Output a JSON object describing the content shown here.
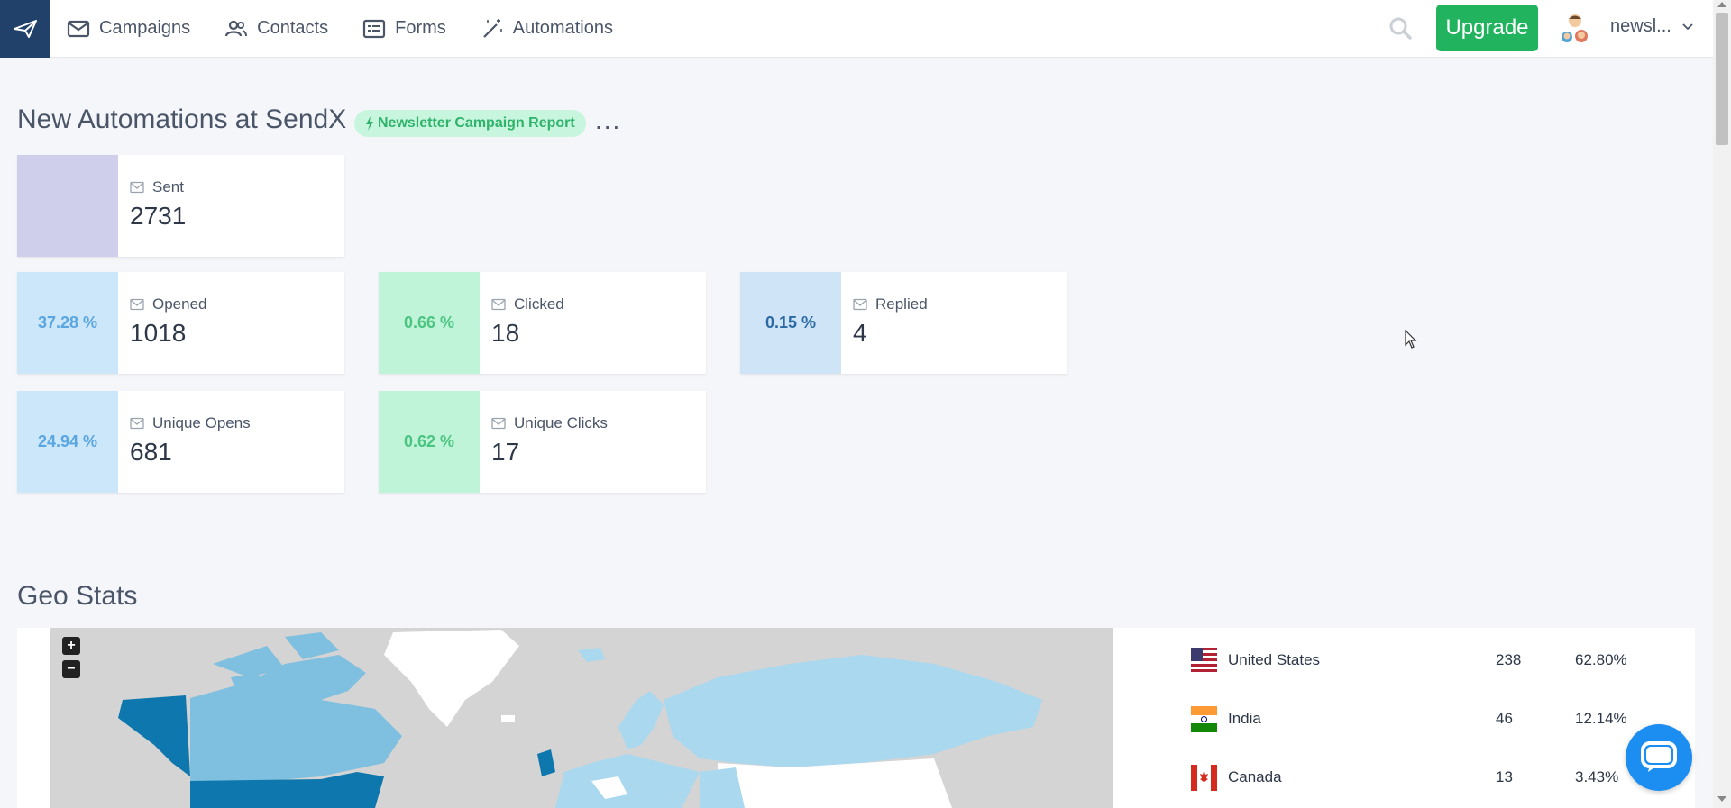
{
  "nav": {
    "items": [
      {
        "label": "Campaigns",
        "icon": "envelope-icon"
      },
      {
        "label": "Contacts",
        "icon": "users-icon"
      },
      {
        "label": "Forms",
        "icon": "form-icon"
      },
      {
        "label": "Automations",
        "icon": "magic-wand-icon"
      }
    ],
    "upgrade_label": "Upgrade",
    "user_name": "newsl..."
  },
  "report": {
    "title": "New Automations at SendX",
    "badge": "Newsletter Campaign Report",
    "more": "...",
    "stats": {
      "sent": {
        "label": "Sent",
        "value": "2731",
        "pct": ""
      },
      "opened": {
        "label": "Opened",
        "value": "1018",
        "pct": "37.28 %"
      },
      "clicked": {
        "label": "Clicked",
        "value": "18",
        "pct": "0.66 %"
      },
      "replied": {
        "label": "Replied",
        "value": "4",
        "pct": "0.15 %"
      },
      "unique_opens": {
        "label": "Unique Opens",
        "value": "681",
        "pct": "24.94 %"
      },
      "unique_clicks": {
        "label": "Unique Clicks",
        "value": "17",
        "pct": "0.62 %"
      }
    }
  },
  "geo": {
    "title": "Geo Stats",
    "zoom_in": "+",
    "zoom_out": "−",
    "rows": [
      {
        "country": "United States",
        "count": "238",
        "pct": "62.80%",
        "flag": "us-flag-icon"
      },
      {
        "country": "India",
        "count": "46",
        "pct": "12.14%",
        "flag": "india-flag-icon"
      },
      {
        "country": "Canada",
        "count": "13",
        "pct": "3.43%",
        "flag": "canada-flag-icon"
      }
    ]
  },
  "colors": {
    "brand_dark": "#22416a",
    "upgrade": "#22b35e",
    "open_blue": "#5aa6e0",
    "click_green": "#4cc482",
    "map_dark": "#0e77ad",
    "map_mid": "#7fbfdf",
    "map_light": "#a9d8ef"
  }
}
